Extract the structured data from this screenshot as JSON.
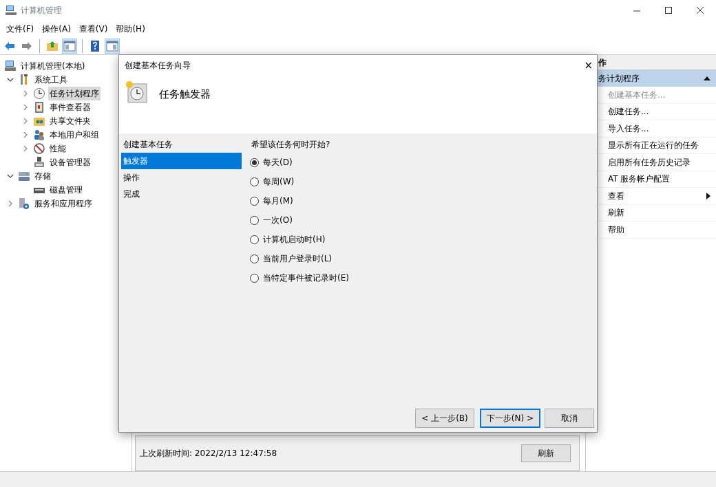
{
  "window": {
    "title": "计算机管理"
  },
  "menu": [
    "文件(F)",
    "操作(A)",
    "查看(V)",
    "帮助(H)"
  ],
  "toolbar": [
    {
      "kind": "back",
      "pressed": false
    },
    {
      "kind": "forward",
      "pressed": false
    },
    {
      "kind": "separator"
    },
    {
      "kind": "up",
      "pressed": false
    },
    {
      "kind": "pane",
      "pressed": true
    },
    {
      "kind": "separator"
    },
    {
      "kind": "help",
      "pressed": false
    },
    {
      "kind": "pane2",
      "pressed": true
    }
  ],
  "tree": [
    {
      "label": "计算机管理(本地)",
      "children": [
        {
          "label": "系统工具",
          "expanded": true,
          "children": [
            {
              "label": "任务计划程序",
              "expanded": false,
              "selected": true
            },
            {
              "label": "事件查看器",
              "expanded": false,
              "selected": false
            },
            {
              "label": "共享文件夹",
              "expanded": false,
              "selected": false
            },
            {
              "label": "本地用户和组",
              "expanded": false,
              "selected": false
            },
            {
              "label": "性能",
              "expanded": false,
              "selected": false
            },
            {
              "label": "设备管理器",
              "selected": false
            }
          ]
        },
        {
          "label": "存储",
          "expanded": true,
          "children": [
            {
              "label": "磁盘管理",
              "selected": false
            }
          ]
        },
        {
          "label": "服务和应用程序",
          "expanded": false
        }
      ]
    }
  ],
  "center": {
    "refresh_text": "上次刷新时间: 2022/2/13 12:47:58",
    "refresh_button": "刷新"
  },
  "actions": {
    "title": "作",
    "section": "务计划程序",
    "items": [
      {
        "label": "创建基本任务...",
        "disabled": true,
        "submenu": false
      },
      {
        "label": "创建任务...",
        "disabled": false,
        "submenu": false
      },
      {
        "label": "导入任务...",
        "disabled": false,
        "submenu": false
      },
      {
        "label": "显示所有正在运行的任务",
        "disabled": false,
        "submenu": false
      },
      {
        "label": "启用所有任务历史记录",
        "disabled": false,
        "submenu": false
      },
      {
        "label": "AT 服务帐户配置",
        "disabled": false,
        "submenu": false
      },
      {
        "label": "查看",
        "disabled": false,
        "submenu": true
      },
      {
        "label": "刷新",
        "disabled": false,
        "submenu": false
      },
      {
        "label": "帮助",
        "disabled": false,
        "submenu": false
      }
    ]
  },
  "dialog": {
    "title": "创建基本任务向导",
    "close": "×",
    "heading": "任务触发器",
    "steps_heading": "创建基本任务",
    "steps": [
      {
        "label": "触发器",
        "selected": true
      },
      {
        "label": "操作",
        "selected": false
      },
      {
        "label": "完成",
        "selected": false
      }
    ],
    "question": "希望该任务何时开始?",
    "options": [
      {
        "label": "每天(D)",
        "selected": true
      },
      {
        "label": "每周(W)",
        "selected": false
      },
      {
        "label": "每月(M)",
        "selected": false
      },
      {
        "label": "一次(O)",
        "selected": false
      },
      {
        "label": "计算机启动时(H)",
        "selected": false
      },
      {
        "label": "当前用户登录时(L)",
        "selected": false
      },
      {
        "label": "当特定事件被记录时(E)",
        "selected": false
      }
    ],
    "buttons": [
      {
        "label": "< 上一步(B)",
        "default": false
      },
      {
        "label": "下一步(N) >",
        "default": true
      },
      {
        "label": "取消",
        "default": false
      }
    ]
  }
}
